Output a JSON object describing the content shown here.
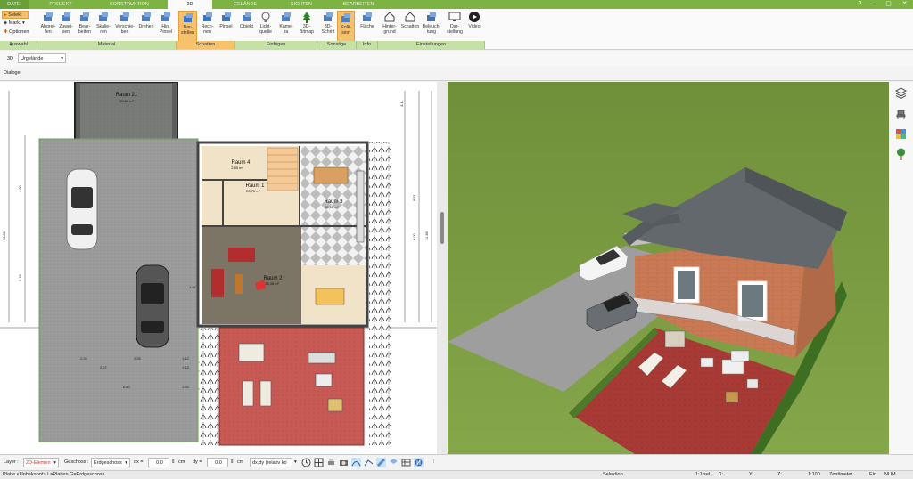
{
  "tabs": [
    "DATEI",
    "PROJEKT",
    "KONSTRUKTION",
    "3D",
    "GELÄNDE",
    "SICHTEN",
    "BEARBEITEN"
  ],
  "window_controls": [
    "?",
    "–",
    "▢",
    "✕"
  ],
  "ribbon": {
    "select_label": "Selekt",
    "mark_label": "Mark.",
    "options_label": "Optionen",
    "buttons": [
      {
        "label": "Abgrei-\nfen"
      },
      {
        "label": "Zuwei-\nsen"
      },
      {
        "label": "Bear-\nbeiten"
      },
      {
        "label": "Skalie-\nren"
      },
      {
        "label": "Verschie-\nben"
      },
      {
        "label": "Drehen"
      },
      {
        "label": "Hin.\nPinsel"
      },
      {
        "label": "Dar-\nstellen"
      },
      {
        "label": "Rech-\nnen"
      },
      {
        "label": "Pinsel"
      },
      {
        "label": "Objekt"
      },
      {
        "label": "Licht-\nquelle"
      },
      {
        "label": "Kame-\nra"
      },
      {
        "label": "3D-\nBitmap"
      },
      {
        "label": "3D-\nSchrift"
      },
      {
        "label": "Kolli-\nsion"
      },
      {
        "label": "Fläche"
      },
      {
        "label": "Hinter-\ngrund"
      },
      {
        "label": "Schatten"
      },
      {
        "label": "Beleuch-\ntung"
      },
      {
        "label": "Dar-\nstellung"
      },
      {
        "label": "Video"
      }
    ],
    "groups": [
      "Auswahl",
      "Material",
      "Schatten",
      "Einfügen",
      "Sonstige",
      "Info",
      "Einstellungen"
    ]
  },
  "view_selector": {
    "mode": "3D",
    "value": "Urgelände"
  },
  "dialog_label": "Dialoge:",
  "plan": {
    "rooms": [
      {
        "name": "Raum 21",
        "area": "20,80 m²"
      },
      {
        "name": "Raum 4",
        "area": "2,85 m²"
      },
      {
        "name": "Raum 1",
        "area": "20,71 m²"
      },
      {
        "name": "Raum 3",
        "area": "25,11 m²"
      },
      {
        "name": "Raum 2",
        "area": "26,45 m²"
      }
    ],
    "dimensions": [
      "2.26",
      "2.07",
      "2.35",
      "6.00",
      "1.12",
      "1.13",
      "1.53",
      "1.07",
      "10.81",
      "4.60",
      "5.76",
      "6.00",
      "11.38",
      "6.51",
      "4.11"
    ]
  },
  "bottombar": {
    "layer_label": "Layer :",
    "layer_value": "2D-Elemen",
    "floor_label": "Geschoss :",
    "floor_value": "Erdgeschoss",
    "dx_label": "dx =",
    "dx_value": "0.0",
    "dy_label": "dy =",
    "dy_value": "0.0",
    "unit1": "cm",
    "unit2": "cm",
    "relative_value": "dx,dy (relativ ko"
  },
  "status": {
    "left": "Platte <Unbekannt> L=Platten G=Erdgeschoss",
    "mode": "Selektion",
    "sel": "1:1 sel",
    "x": "X:",
    "y": "Y:",
    "z": "Z:",
    "scale": "1:100",
    "unit": "Zentimeter",
    "ein": "Ein",
    "num": "NUM"
  },
  "colors": {
    "ribbon_green": "#7cb342",
    "group_green": "#c5e1a5",
    "active_orange": "#f5c16c",
    "red_terrace": "#b5403c"
  }
}
